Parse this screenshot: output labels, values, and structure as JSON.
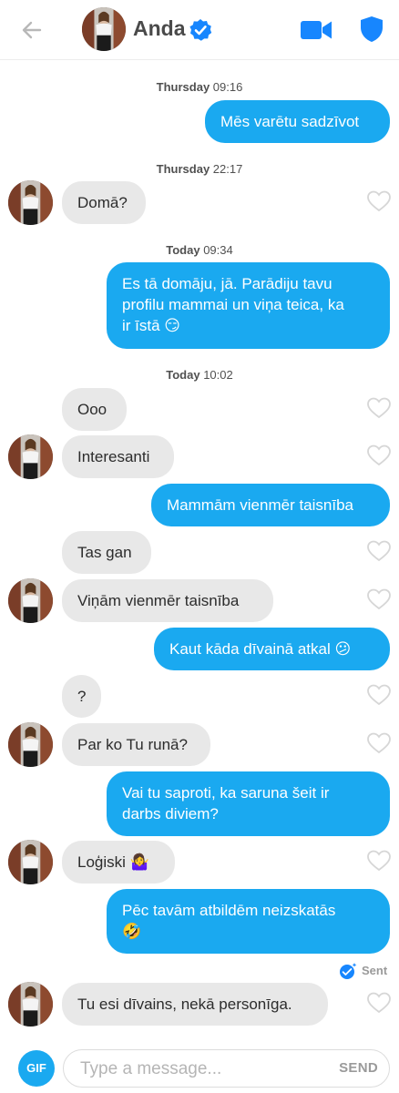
{
  "header": {
    "name": "Anda",
    "colors": {
      "accent": "#1AA9F0",
      "verified": "#1786FE"
    }
  },
  "timestamps": [
    {
      "day": "Thursday",
      "time": "09:16"
    },
    {
      "day": "Thursday",
      "time": "22:17"
    },
    {
      "day": "Today",
      "time": "09:34"
    },
    {
      "day": "Today",
      "time": "10:02"
    }
  ],
  "messages": [
    {
      "from": "me",
      "text": "Mēs varētu sadzīvot"
    },
    {
      "from": "them",
      "text": "Domā?"
    },
    {
      "from": "me",
      "lines": [
        "Es tā domāju, jā. Parādiju tavu",
        "profilu mammai un viņa teica, ka",
        "ir īstā 😏"
      ]
    },
    {
      "from": "them",
      "text": "Ooo"
    },
    {
      "from": "them",
      "text": "Interesanti"
    },
    {
      "from": "me",
      "text": "Mammām vienmēr taisnība"
    },
    {
      "from": "them",
      "text": "Tas gan"
    },
    {
      "from": "them",
      "text": "Viņām vienmēr taisnība"
    },
    {
      "from": "me",
      "text": "Kaut kāda dīvainā atkal 😕"
    },
    {
      "from": "them",
      "text": "?"
    },
    {
      "from": "them",
      "text": "Par ko Tu runā?"
    },
    {
      "from": "me",
      "lines": [
        "Vai tu saproti, ka saruna šeit ir",
        "darbs diviem?"
      ]
    },
    {
      "from": "them",
      "text": "Loģiski 🤷‍♀️"
    },
    {
      "from": "me",
      "lines": [
        "Pēc tavām atbildēm neizskatās",
        "🤣"
      ]
    },
    {
      "from": "them",
      "text": "Tu esi dīvains, nekā personīga."
    }
  ],
  "status": {
    "sent_label": "Sent"
  },
  "composer": {
    "gif_label": "GIF",
    "placeholder": "Type a message...",
    "send_label": "SEND"
  }
}
